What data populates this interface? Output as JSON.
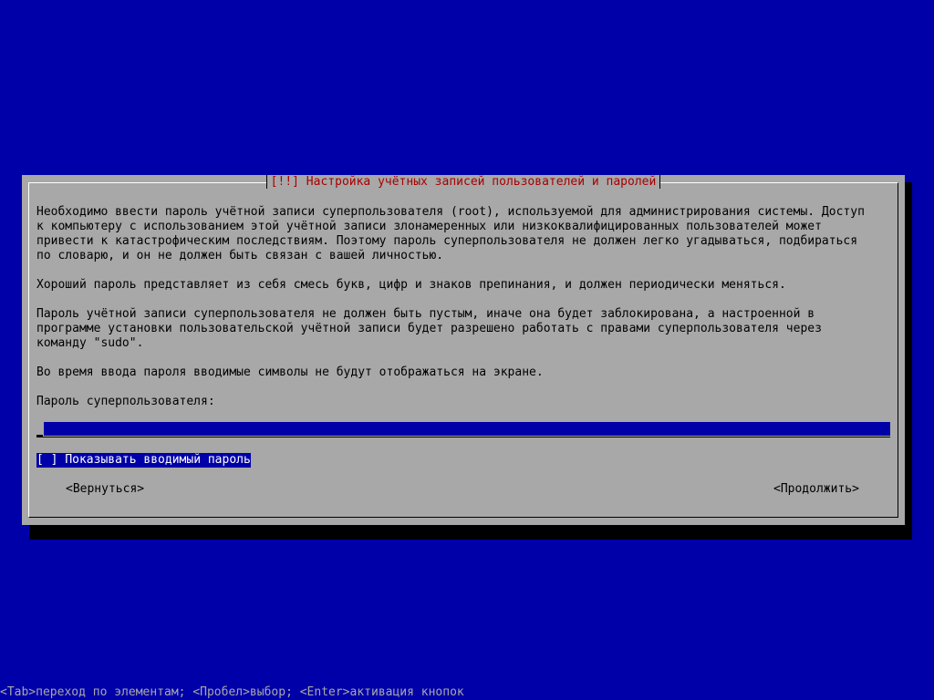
{
  "dialog": {
    "title": "[!!] Настройка учётных записей пользователей и паролей",
    "paragraphs": [
      "Необходимо ввести пароль учётной записи суперпользователя (root), используемой для администрирования системы. Доступ\nк компьютеру с использованием этой учётной записи злонамеренных или низкоквалифицированных пользователей может\nпривести к катастрофическим последствиям. Поэтому пароль суперпользователя не должен легко угадываться, подбираться\nпо словарю, и он не должен быть связан с вашей личностью.",
      "Хороший пароль представляет из себя смесь букв, цифр и знаков препинания, и должен периодически меняться.",
      "Пароль учётной записи суперпользователя не должен быть пустым, иначе она будет заблокирована, а настроенной в\nпрограмме установки пользовательской учётной записи будет разрешено работать с правами суперпользователя через\nкоманду \"sudo\".",
      "Во время ввода пароля вводимые символы не будут отображаться на экране."
    ],
    "password_label": "Пароль суперпользователя:",
    "password_value": "",
    "show_password": {
      "box": "[ ]",
      "label": "Показывать вводимый пароль",
      "checked": false
    },
    "back_button": "<Вернуться>",
    "continue_button": "<Продолжить>"
  },
  "status_bar": {
    "hint": "<Tab>переход по элементам; <Пробел>выбор; <Enter>активация кнопок"
  },
  "colors": {
    "background": "#0000a8",
    "dialog": "#a8a8a8",
    "title": "#a80000",
    "selection": "#0000a8"
  }
}
